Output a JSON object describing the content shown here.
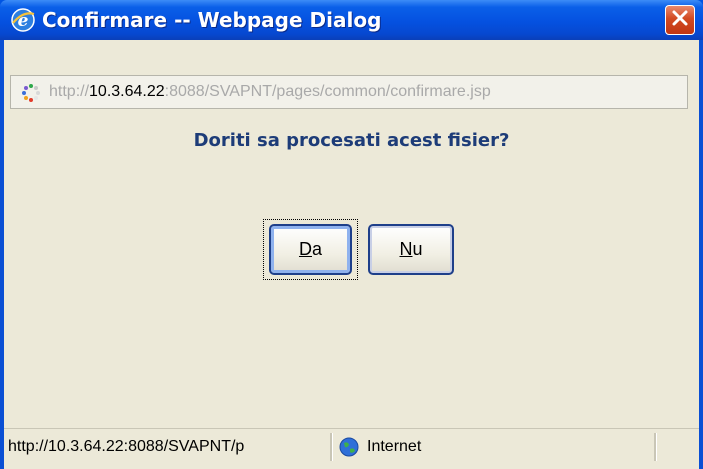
{
  "window": {
    "title": "Confirmare -- Webpage Dialog",
    "title_icon": "ie-icon",
    "close_icon": "close-icon"
  },
  "address": {
    "prefix": "http://",
    "host": "10.3.64.22",
    "rest": ":8088/SVAPNT/pages/common/confirmare.jsp",
    "icon": "loading-icon"
  },
  "dialog": {
    "question": "Doriti sa procesati acest fisier?"
  },
  "buttons": {
    "yes": {
      "accesskey": "D",
      "rest": "a"
    },
    "no": {
      "accesskey": "N",
      "rest": "u"
    }
  },
  "status": {
    "url": "http://10.3.64.22:8088/SVAPNT/p",
    "zone": "Internet",
    "zone_icon": "globe-icon"
  },
  "colors": {
    "title_bar": "#0551e0",
    "close_button": "#d24a22",
    "question_text": "#1d3c78",
    "dialog_background": "#ece9d8"
  }
}
